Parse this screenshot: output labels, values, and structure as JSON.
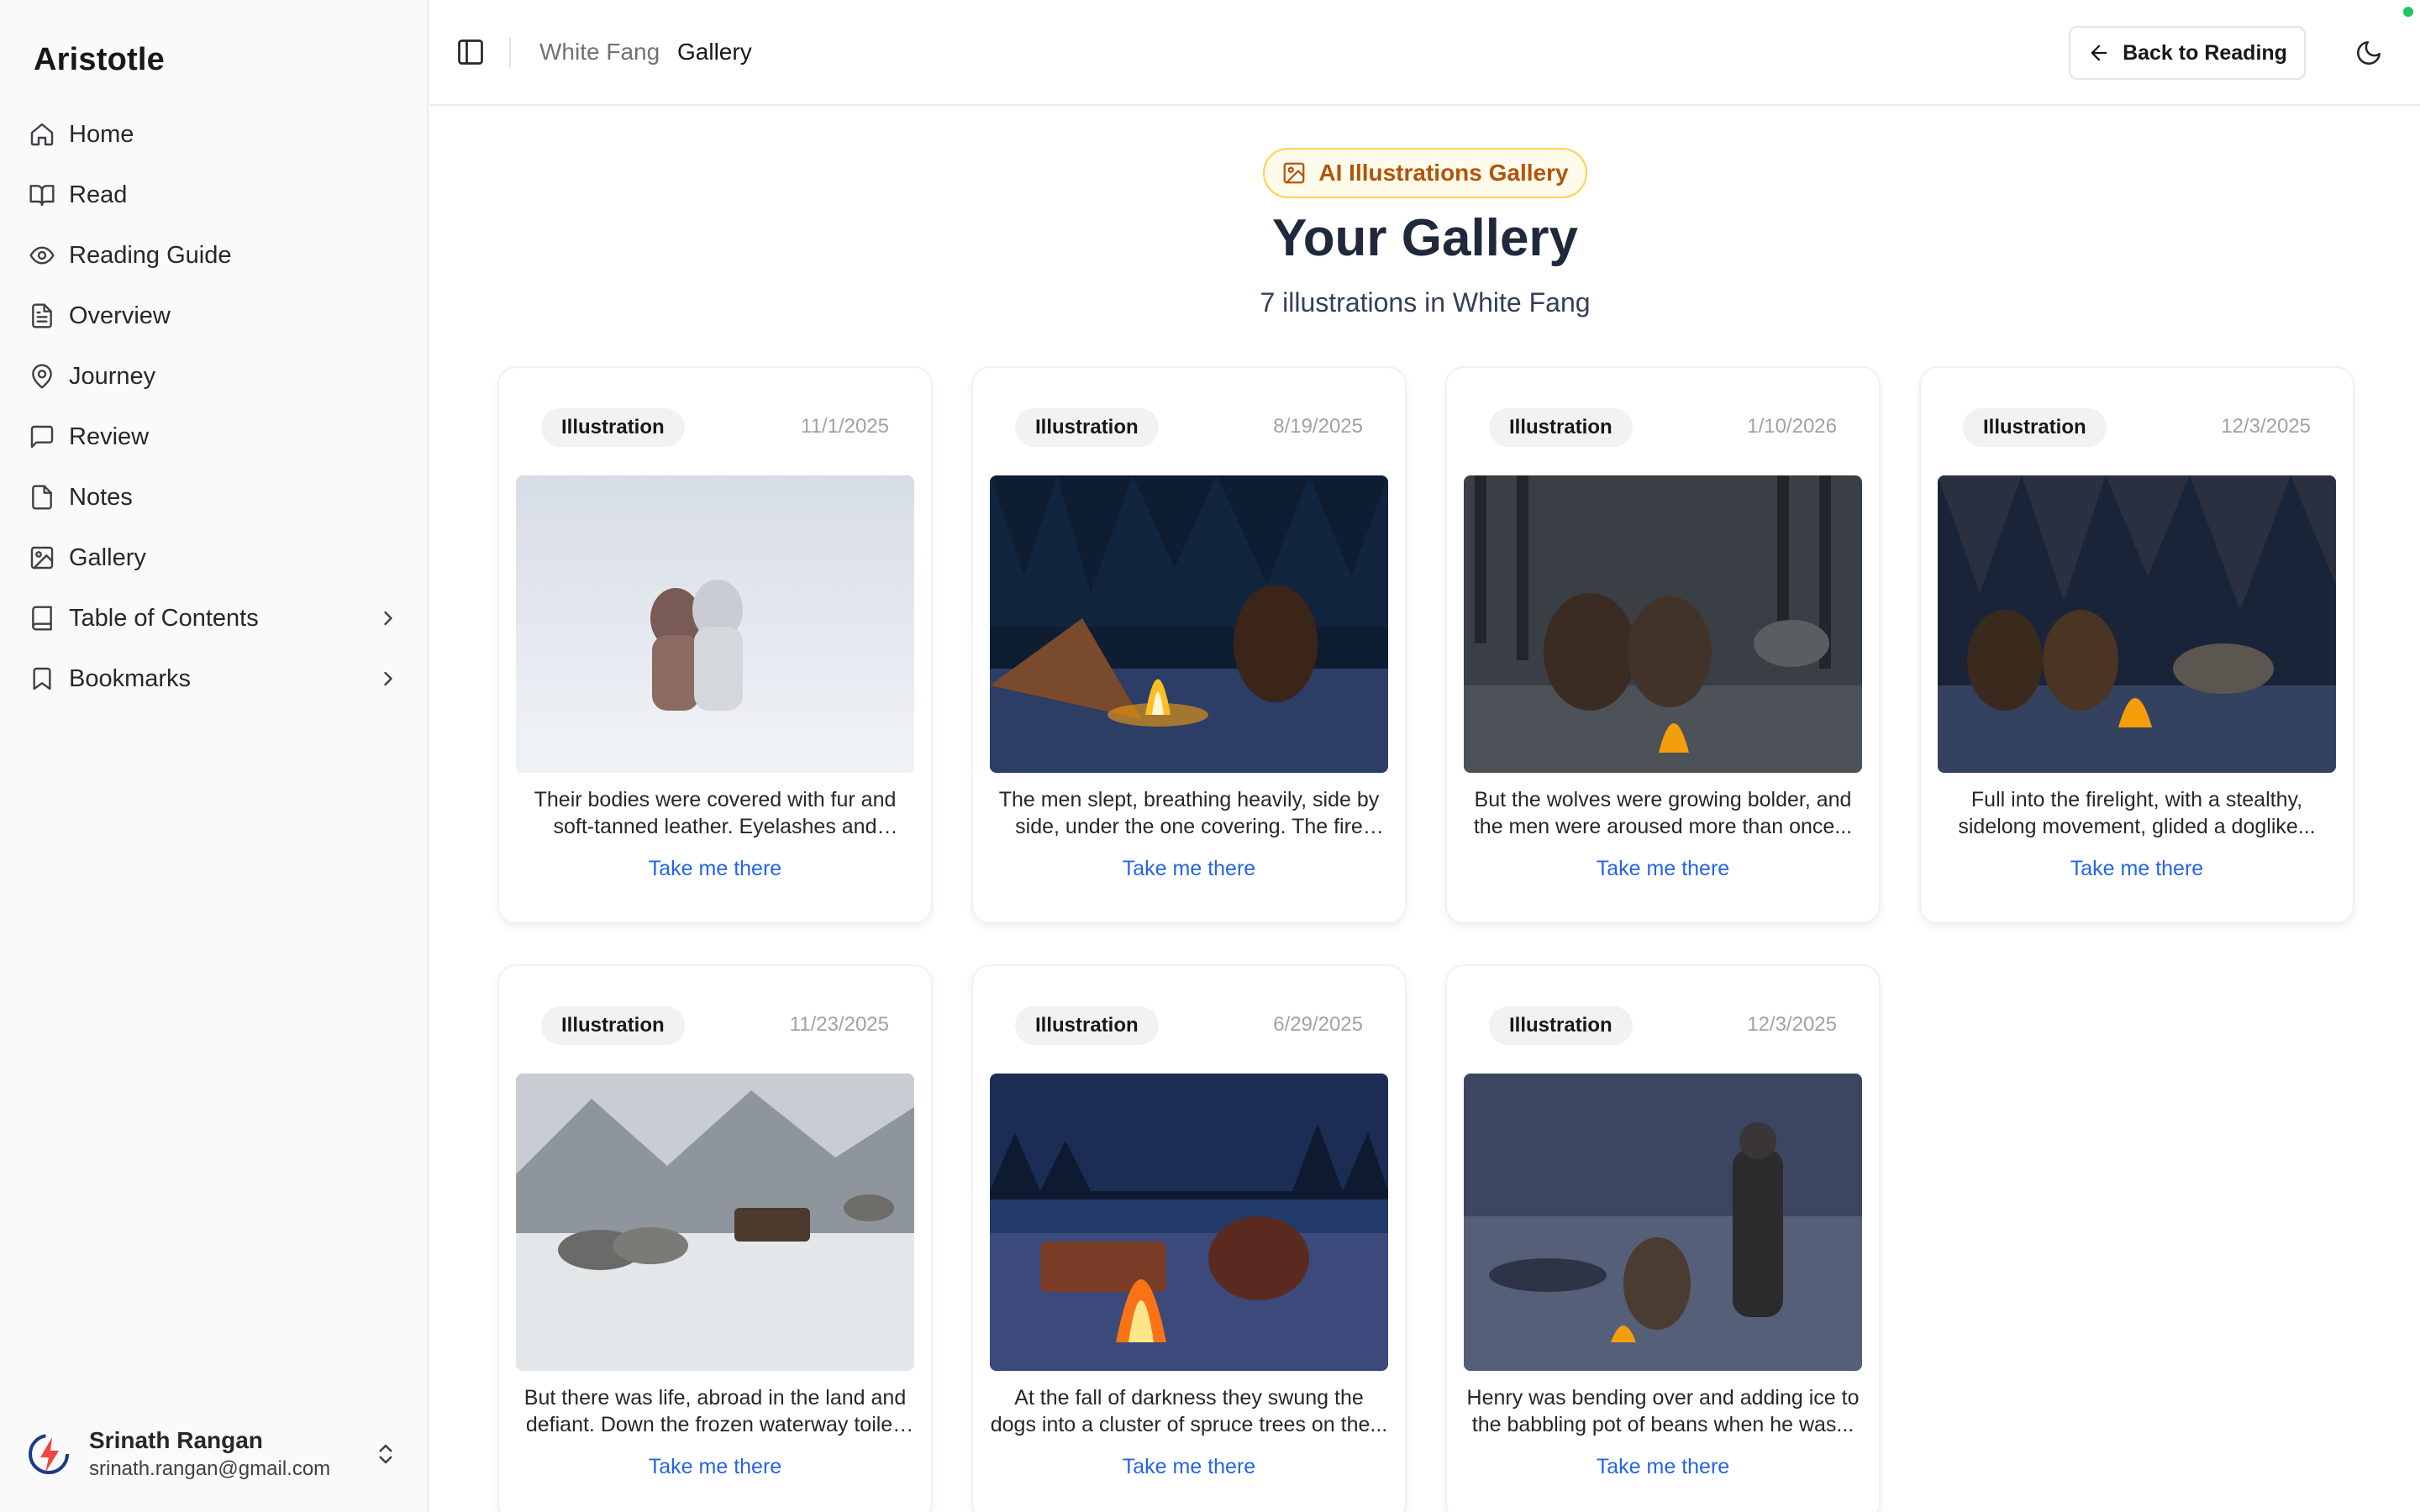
{
  "sidebar": {
    "brand": "Aristotle",
    "items": [
      {
        "label": "Home"
      },
      {
        "label": "Read"
      },
      {
        "label": "Reading Guide"
      },
      {
        "label": "Overview"
      },
      {
        "label": "Journey"
      },
      {
        "label": "Review"
      },
      {
        "label": "Notes"
      },
      {
        "label": "Gallery"
      },
      {
        "label": "Table of Contents"
      },
      {
        "label": "Bookmarks"
      }
    ],
    "user": {
      "name": "Srinath Rangan",
      "email": "srinath.rangan@gmail.com"
    }
  },
  "header": {
    "book": "White Fang",
    "page": "Gallery",
    "back_label": "Back to Reading"
  },
  "main": {
    "badge": "AI Illustrations Gallery",
    "title": "Your Gallery",
    "subtitle": "7 illustrations in White Fang",
    "cards": [
      {
        "tag": "Illustration",
        "date": "11/1/2025",
        "caption": "Their bodies were covered with fur and soft-tanned leather. Eyelashes and cheek...",
        "link": "Take me there"
      },
      {
        "tag": "Illustration",
        "date": "8/19/2025",
        "caption": "The men slept, breathing heavily, side by side, under the one covering. The fire die...",
        "link": "Take me there"
      },
      {
        "tag": "Illustration",
        "date": "1/10/2026",
        "caption": "But the wolves were growing bolder, and the men were aroused more than once...",
        "link": "Take me there"
      },
      {
        "tag": "Illustration",
        "date": "12/3/2025",
        "caption": "Full into the firelight, with a stealthy, sidelong movement, glided a doglike...",
        "link": "Take me there"
      },
      {
        "tag": "Illustration",
        "date": "11/23/2025",
        "caption": "But there was life, abroad in the land and defiant. Down the frozen waterway toiled ...",
        "link": "Take me there"
      },
      {
        "tag": "Illustration",
        "date": "6/29/2025",
        "caption": "At the fall of darkness they swung the dogs into a cluster of spruce trees on the...",
        "link": "Take me there"
      },
      {
        "tag": "Illustration",
        "date": "12/3/2025",
        "caption": "Henry was bending over and adding ice to the babbling pot of beans when he was...",
        "link": "Take me there"
      }
    ]
  },
  "colors": {
    "accent_link": "#2563eb",
    "badge_text": "#b45309",
    "badge_bg": "#fffbeb",
    "status_online": "#22c55e"
  }
}
